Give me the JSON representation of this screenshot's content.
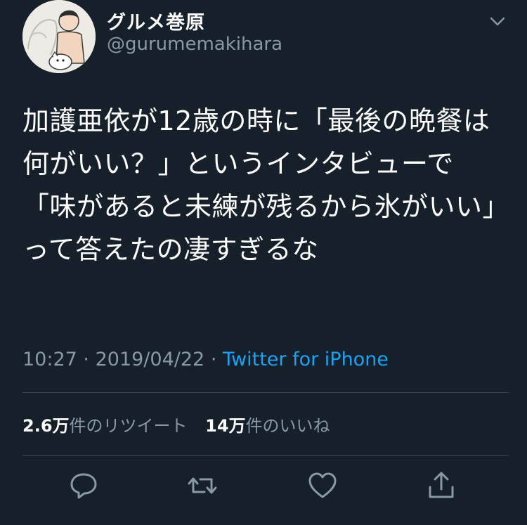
{
  "user": {
    "display_name": "グルメ巻原",
    "handle": "@gurumemakihara"
  },
  "tweet": {
    "text": "加護亜依が12歳の時に「最後の晩餐は何がいい？」というインタビューで「味があると未練が残るから氷がいい」って答えたの凄すぎるな",
    "time": "10:27",
    "separator": "·",
    "date": "2019/04/22",
    "source": "Twitter for iPhone"
  },
  "stats": {
    "retweets_count": "2.6万",
    "retweets_label": "件のリツイート",
    "likes_count": "14万",
    "likes_label": "件のいいね"
  },
  "icons": {
    "menu": "chevron-down-icon",
    "reply": "reply-icon",
    "retweet": "retweet-icon",
    "like": "heart-icon",
    "share": "share-icon"
  },
  "colors": {
    "background": "#15202b",
    "text": "#ffffff",
    "secondary": "#8899a6",
    "link": "#1da1f2",
    "divider": "#38444d"
  }
}
